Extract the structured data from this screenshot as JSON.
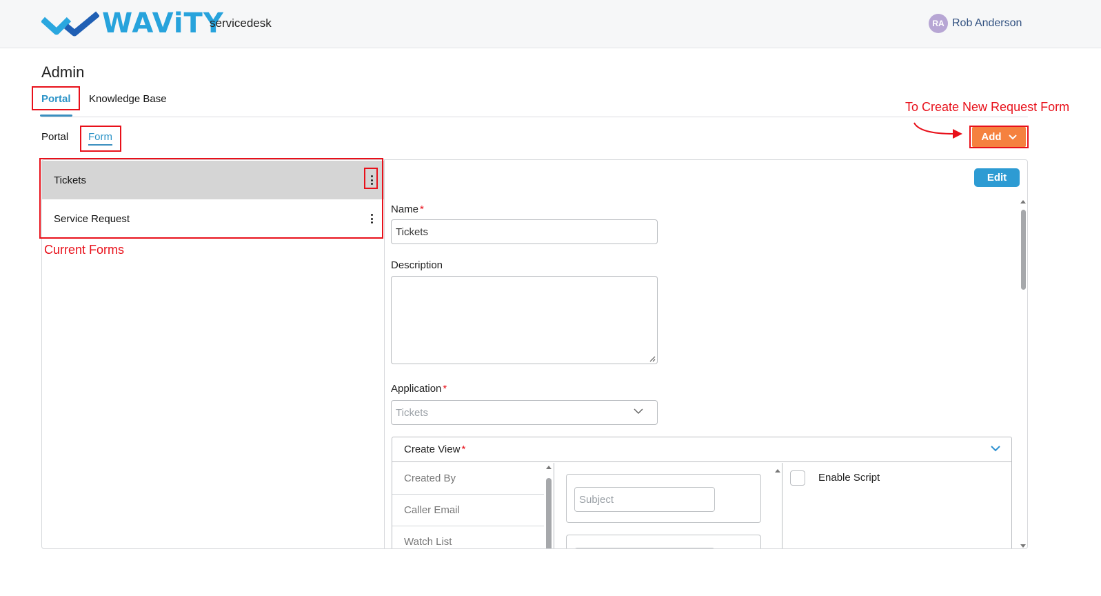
{
  "brand": {
    "logo_text": "WAViTY",
    "product": "servicedesk"
  },
  "user": {
    "initials": "RA",
    "name": "Rob Anderson"
  },
  "page": {
    "title": "Admin"
  },
  "main_tabs": [
    {
      "label": "Portal",
      "active": true
    },
    {
      "label": "Knowledge Base",
      "active": false
    }
  ],
  "sub_tabs": [
    {
      "label": "Portal",
      "active": false
    },
    {
      "label": "Form",
      "active": true
    }
  ],
  "toolbar": {
    "add_label": "Add",
    "edit_label": "Edit"
  },
  "forms": [
    {
      "label": "Tickets",
      "selected": true
    },
    {
      "label": "Service Request",
      "selected": false
    }
  ],
  "annotations": {
    "current_forms": "Current Forms",
    "create_new": "To Create New Request Form"
  },
  "detail": {
    "name_label": "Name",
    "name_value": "Tickets",
    "description_label": "Description",
    "description_value": "",
    "application_label": "Application",
    "application_value": "Tickets",
    "required_mark": "*",
    "create_view": {
      "label": "Create View",
      "available_fields": [
        "Created By",
        "Caller Email",
        "Watch List"
      ],
      "placed_fields": [
        "Subject"
      ],
      "enable_script_label": "Enable Script",
      "enable_script_checked": false
    }
  },
  "colors": {
    "accent": "#2d9bd3",
    "add_button": "#f5813f",
    "annotation": "#e8101a",
    "selected_row": "#d5d5d5"
  },
  "icons": [
    "kebab-menu-icon",
    "chevron-down-icon",
    "arrow-right-icon",
    "resize-handle-icon"
  ]
}
